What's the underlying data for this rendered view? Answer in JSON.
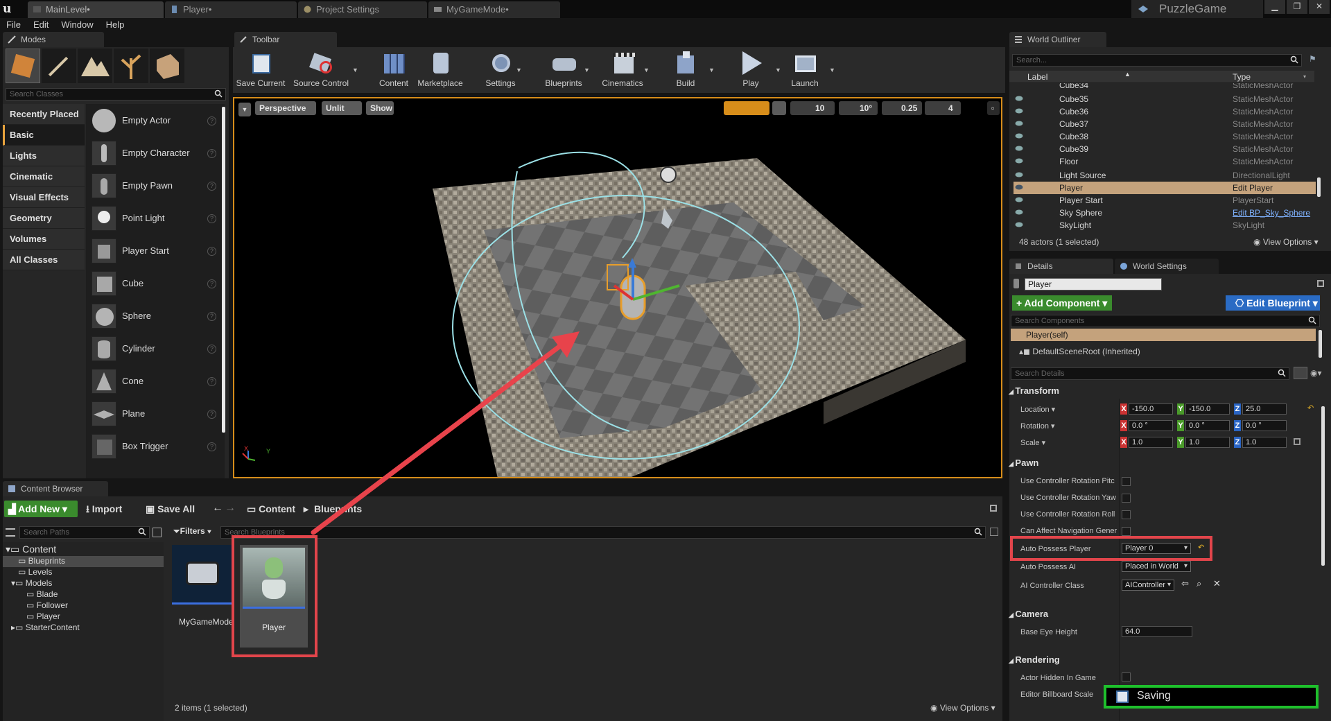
{
  "window": {
    "project": "PuzzleGame",
    "tabs": [
      "MainLevel•",
      "Player•",
      "Project Settings",
      "MyGameMode•"
    ]
  },
  "menu": [
    "File",
    "Edit",
    "Window",
    "Help"
  ],
  "modes": {
    "tab": "Modes",
    "search_placeholder": "Search Classes",
    "categories": [
      "Recently Placed",
      "Basic",
      "Lights",
      "Cinematic",
      "Visual Effects",
      "Geometry",
      "Volumes",
      "All Classes"
    ],
    "selected_category": "Basic",
    "items": [
      "Empty Actor",
      "Empty Character",
      "Empty Pawn",
      "Point Light",
      "Player Start",
      "Cube",
      "Sphere",
      "Cylinder",
      "Cone",
      "Plane",
      "Box Trigger"
    ]
  },
  "toolbar": {
    "tab": "Toolbar",
    "buttons": [
      "Save Current",
      "Source Control",
      "Content",
      "Marketplace",
      "Settings",
      "Blueprints",
      "Cinematics",
      "Build",
      "Play",
      "Launch"
    ]
  },
  "viewport": {
    "perspective": "Perspective",
    "lit": "Unlit",
    "show": "Show",
    "grid": "10",
    "angle": "10°",
    "scale": "0.25",
    "cam_speed": "4",
    "axis_x": "X",
    "axis_y": "Y"
  },
  "outliner": {
    "tab": "World Outliner",
    "search_placeholder": "Search...",
    "col_label": "Label",
    "col_type": "Type",
    "rows": [
      {
        "label": "Cube34",
        "type": "StaticMeshActor"
      },
      {
        "label": "Cube35",
        "type": "StaticMeshActor"
      },
      {
        "label": "Cube36",
        "type": "StaticMeshActor"
      },
      {
        "label": "Cube37",
        "type": "StaticMeshActor"
      },
      {
        "label": "Cube38",
        "type": "StaticMeshActor"
      },
      {
        "label": "Cube39",
        "type": "StaticMeshActor"
      },
      {
        "label": "Floor",
        "type": "StaticMeshActor"
      },
      {
        "label": "Light Source",
        "type": "DirectionalLight"
      },
      {
        "label": "Player",
        "type": "Edit Player"
      },
      {
        "label": "Player Start",
        "type": "PlayerStart"
      },
      {
        "label": "Sky Sphere",
        "type": "Edit BP_Sky_Sphere"
      },
      {
        "label": "SkyLight",
        "type": "SkyLight"
      }
    ],
    "status": "48 actors (1 selected)",
    "view_options": "View Options"
  },
  "details": {
    "tab": "Details",
    "tab2": "World Settings",
    "name": "Player",
    "add_component": "+ Add Component",
    "edit_blueprint": "Edit Blueprint",
    "search_components": "Search Components",
    "self": "Player(self)",
    "root": "DefaultSceneRoot (Inherited)",
    "search_details": "Search Details",
    "transform": {
      "title": "Transform",
      "location_label": "Location",
      "rotation_label": "Rotation",
      "scale_label": "Scale",
      "location": [
        "-150.0",
        "-150.0",
        "25.0"
      ],
      "rotation": [
        "0.0 °",
        "0.0 °",
        "0.0 °"
      ],
      "scale": [
        "1.0",
        "1.0",
        "1.0"
      ]
    },
    "pawn": {
      "title": "Pawn",
      "props": [
        "Use Controller Rotation Pitc",
        "Use Controller Rotation Yaw",
        "Use Controller Rotation Roll",
        "Can Affect Navigation Gener"
      ],
      "auto_possess_player_label": "Auto Possess Player",
      "auto_possess_player": "Player 0",
      "auto_possess_ai_label": "Auto Possess AI",
      "auto_possess_ai": "Placed in World",
      "ai_controller_label": "AI Controller Class",
      "ai_controller": "AIController"
    },
    "camera": {
      "title": "Camera",
      "base_eye_label": "Base Eye Height",
      "base_eye": "64.0"
    },
    "rendering": {
      "title": "Rendering",
      "props": [
        "Actor Hidden In Game",
        "Editor Billboard Scale"
      ]
    },
    "saving": "Saving"
  },
  "content_browser": {
    "tab": "Content Browser",
    "add_new": "Add New",
    "import": "Import",
    "save_all": "Save All",
    "path": [
      "Content",
      "Blueprints"
    ],
    "search_paths": "Search Paths",
    "filters": "Filters",
    "search_placeholder": "Search Blueprints",
    "tree": [
      "Content",
      "Blueprints",
      "Levels",
      "Models",
      "Blade",
      "Follower",
      "Player",
      "StarterContent"
    ],
    "assets": [
      "MyGameMode",
      "Player"
    ],
    "status": "2 items (1 selected)",
    "view_options": "View Options"
  }
}
